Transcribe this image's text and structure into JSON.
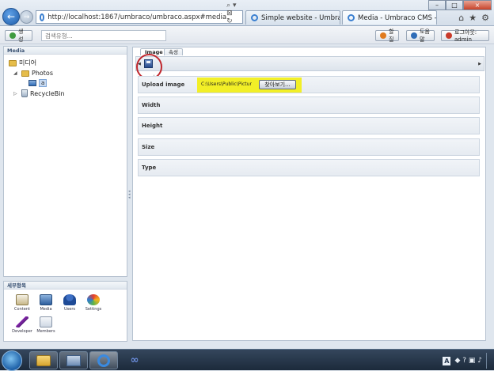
{
  "browser": {
    "url": "http://localhost:1867/umbraco/umbraco.aspx#media",
    "tabs": [
      {
        "label": "Simple website - Umbraco C..."
      },
      {
        "label": "Media - Umbraco CMS - l..."
      }
    ],
    "tab_close": "×",
    "address_icons": "⌕ ▾ ⊠ ↻ ×",
    "controls": {
      "minimize": "–",
      "maximize": "□",
      "close": "×"
    },
    "toolbar_icons": {
      "home": "⌂",
      "favorites": "★",
      "tools": "⚙"
    },
    "accent": "#1f5ca8"
  },
  "header": {
    "create_label": "생성",
    "search_placeholder": "검색유형...",
    "help_label": "할질",
    "about_label": "도움말",
    "logout_label": "로그아웃: admin"
  },
  "tree": {
    "title": "Media",
    "root": "미디어",
    "photos": "Photos",
    "image": "a",
    "recycle_bin": "RecycleBin"
  },
  "sections": {
    "title": "세부항목",
    "items": {
      "content": "Content",
      "media": "Media",
      "users": "Users",
      "settings": "Settings",
      "developer": "Developer",
      "members": "Members"
    }
  },
  "editor": {
    "tabs": {
      "image": "Image",
      "properties": "속성"
    },
    "fields": {
      "upload_label": "Upload image",
      "upload_path": "C:\\Users\\Public\\Pictur",
      "browse_label": "찾아보기...",
      "width_label": "Width",
      "height_label": "Height",
      "size_label": "Size",
      "type_label": "Type"
    },
    "highlight_color": "#f2ef27",
    "annotation_color": "#c0272d"
  },
  "taskbar": {
    "lang": "A",
    "tray_icons": "◆ ? ▣ ♪"
  }
}
